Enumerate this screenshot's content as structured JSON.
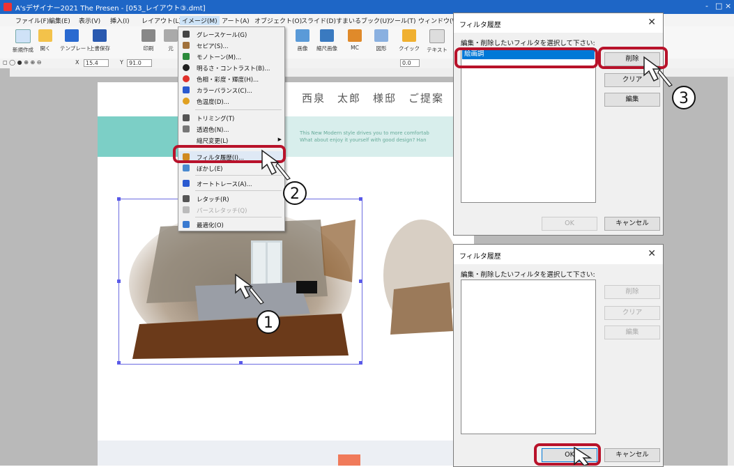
{
  "app": {
    "title": "A'sデザイナー2021 The Presen - [053_レイアウト③.dmt]",
    "window_controls": [
      "-",
      "□",
      "×"
    ]
  },
  "menubar": [
    "ファイル(F)",
    "編集(E)",
    "表示(V)",
    "挿入(I)",
    "レイアウト(L)",
    "イメージ(M)",
    "アート(A)",
    "オブジェクト(O)",
    "スライド(D)",
    "すまいるブック(U)",
    "ツール(T)",
    "ウィンドウ(W)"
  ],
  "toolbar": {
    "buttons": [
      "新規作成",
      "開く",
      "テンプレート",
      "上書保存",
      "印刷",
      "元"
    ],
    "right_buttons": [
      "画像",
      "縮尺画像",
      "MC",
      "図形",
      "クイック",
      "テキスト"
    ]
  },
  "status": {
    "x_label": "X",
    "x_value": "15.4",
    "y_label": "Y",
    "y_value": "91.0",
    "angle_value": "0.0"
  },
  "image_menu": {
    "items": [
      {
        "label": "グレースケール(G)",
        "color": "#444444"
      },
      {
        "label": "セピア(S)...",
        "color": "#a0703a"
      },
      {
        "label": "モノトーン(M)...",
        "color": "#2a8a3a"
      },
      {
        "label": "明るさ・コントラスト(B)...",
        "color": "#222222"
      },
      {
        "label": "色相・彩度・輝度(H)...",
        "color": "#e0302a"
      },
      {
        "label": "カラーバランス(C)...",
        "color": "#2a5ad0"
      },
      {
        "label": "色温度(D)...",
        "color": "#e0a020"
      },
      {
        "label": "トリミング(T)",
        "color": "#555555"
      },
      {
        "label": "透過色(N)...",
        "color": "#777777"
      },
      {
        "label": "縮尺変更(L)",
        "color": "#f1f1f1"
      },
      {
        "label": "フィルタ履歴(I)...",
        "color": "#d08a20"
      },
      {
        "label": "ぼかし(E)",
        "color": "#4a8ad0"
      },
      {
        "label": "オートトレース(A)...",
        "color": "#2a5ad0"
      },
      {
        "label": "レタッチ(R)",
        "color": "#555555"
      },
      {
        "label": "パースレタッチ(Q)",
        "color": "#999999"
      },
      {
        "label": "最適化(O)",
        "color": "#3a7ad0"
      }
    ]
  },
  "slide": {
    "title": "西泉　太郎　様邸　ご提案",
    "english_line1": "This New Modern style drives you to more comfortab",
    "english_line2": "What about enjoy it yourself with good design? Han"
  },
  "dialog_top": {
    "title": "フィルタ履歴",
    "prompt": "編集・削除したいフィルタを選択して下さい:",
    "list_items": [
      "絵画調"
    ],
    "delete_label": "削除",
    "clear_label": "クリア",
    "edit_label": "編集",
    "ok_label": "OK",
    "cancel_label": "キャンセル"
  },
  "dialog_bottom": {
    "title": "フィルタ履歴",
    "prompt": "編集・削除したいフィルタを選択して下さい:",
    "delete_label": "削除",
    "clear_label": "クリア",
    "edit_label": "編集",
    "ok_label": "OK",
    "cancel_label": "キャンセル"
  },
  "callouts": [
    "1",
    "2",
    "3"
  ],
  "colors": {
    "titlebar": "#1e66c6",
    "highlight": "#b8122a",
    "selection": "#0078d7",
    "teal": "#7ccfc6"
  }
}
